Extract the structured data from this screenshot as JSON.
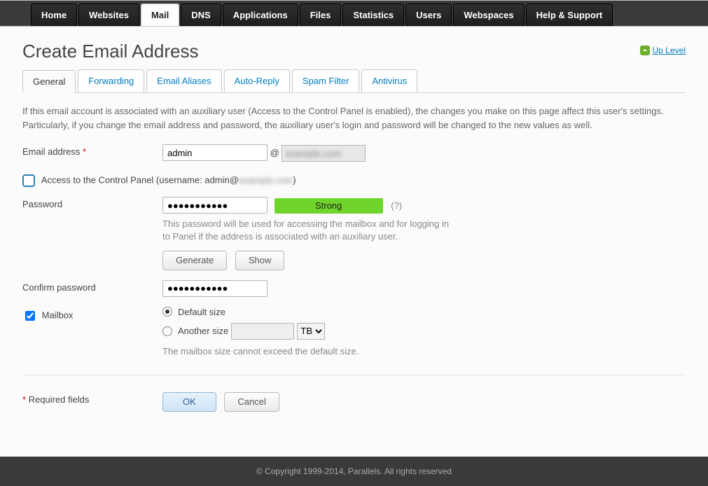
{
  "topnav": {
    "items": [
      "Home",
      "Websites",
      "Mail",
      "DNS",
      "Applications",
      "Files",
      "Statistics",
      "Users",
      "Webspaces",
      "Help & Support"
    ],
    "active_index": 2
  },
  "uplevel_label": "Up Level",
  "page_title": "Create Email Address",
  "subtabs": {
    "items": [
      "General",
      "Forwarding",
      "Email Aliases",
      "Auto-Reply",
      "Spam Filter",
      "Antivirus"
    ],
    "active_index": 0
  },
  "description": "If this email account is associated with an auxiliary user (Access to the Control Panel is enabled), the changes you make on this page affect this user's settings. Particularly, if you change the email address and password, the auxiliary user's login and password will be changed to the new values as well.",
  "form": {
    "email_label": "Email address",
    "email_value": "admin",
    "at": "@",
    "domain_placeholder": "example.com",
    "access_label_pre": "Access to the Control Panel (username: admin@",
    "access_label_domain": "example.com",
    "access_label_post": ")",
    "password_label": "Password",
    "password_value": "●●●●●●●●●●●",
    "strength_label": "Strong",
    "help_marker": "(?)",
    "password_hint": "This password will be used for accessing the mailbox and for logging in to Panel if the address is associated with an auxiliary user.",
    "generate_btn": "Generate",
    "show_btn": "Show",
    "confirm_label": "Confirm password",
    "confirm_value": "●●●●●●●●●●●",
    "mailbox_label": "Mailbox",
    "size_default": "Default size",
    "size_another": "Another size",
    "size_unit": "TB",
    "size_hint": "The mailbox size cannot exceed the default size.",
    "required_note": "Required fields",
    "ok_btn": "OK",
    "cancel_btn": "Cancel"
  },
  "footer": "© Copyright 1999-2014, Parallels. All rights reserved"
}
